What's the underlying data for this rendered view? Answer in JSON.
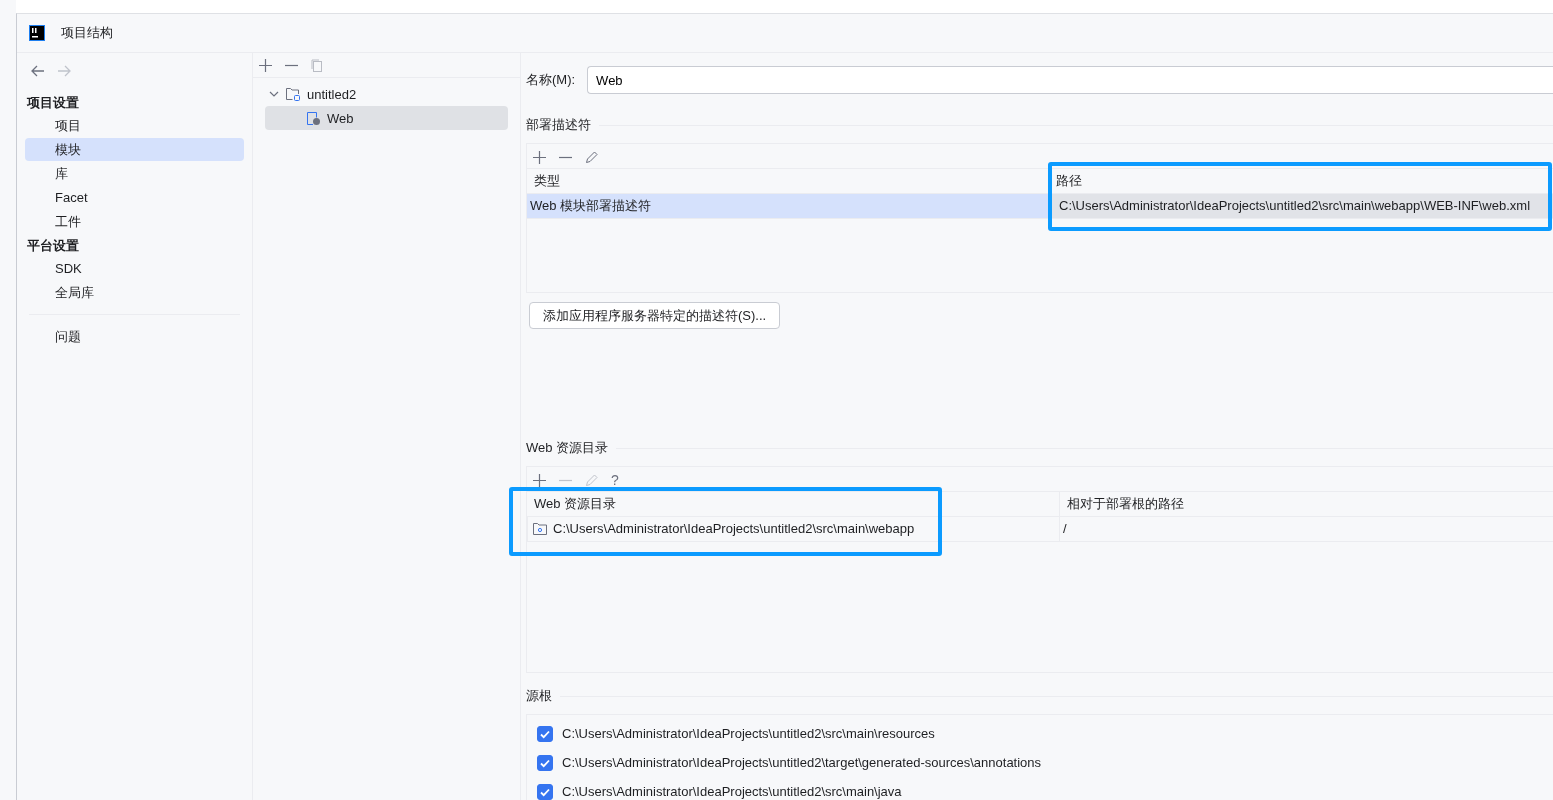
{
  "window": {
    "title": "项目结构"
  },
  "sidebar": {
    "sections": [
      {
        "heading": "项目设置",
        "items": [
          {
            "label": "项目",
            "selected": false
          },
          {
            "label": "模块",
            "selected": true
          },
          {
            "label": "库",
            "selected": false
          },
          {
            "label": "Facet",
            "selected": false
          },
          {
            "label": "工件",
            "selected": false
          }
        ]
      },
      {
        "heading": "平台设置",
        "items": [
          {
            "label": "SDK",
            "selected": false
          },
          {
            "label": "全局库",
            "selected": false
          }
        ]
      }
    ],
    "extra_items": [
      {
        "label": "问题",
        "selected": false
      }
    ]
  },
  "module_tree": [
    {
      "label": "untitled2",
      "expanded": true,
      "selected": false,
      "children": [
        {
          "label": "Web",
          "selected": true
        }
      ]
    }
  ],
  "name_field": {
    "label": "名称(M):",
    "value": "Web"
  },
  "deployment_descriptors": {
    "heading": "部署描述符",
    "columns": [
      "类型",
      "路径"
    ],
    "rows": [
      {
        "cells": [
          "Web 模块部署描述符",
          "C:\\Users\\Administrator\\IdeaProjects\\untitled2\\src\\main\\webapp\\WEB-INF\\web.xml"
        ],
        "selected": true
      }
    ],
    "add_button": "添加应用程序服务器特定的描述符(S)..."
  },
  "web_resources": {
    "heading": "Web 资源目录",
    "columns": [
      "Web 资源目录",
      "相对于部署根的路径"
    ],
    "rows": [
      {
        "cells": [
          "C:\\Users\\Administrator\\IdeaProjects\\untitled2\\src\\main\\webapp",
          "/"
        ],
        "selected": false
      }
    ],
    "help": "?"
  },
  "source_roots": {
    "heading": "源根",
    "items": [
      {
        "path": "C:\\Users\\Administrator\\IdeaProjects\\untitled2\\src\\main\\resources",
        "checked": true
      },
      {
        "path": "C:\\Users\\Administrator\\IdeaProjects\\untitled2\\target\\generated-sources\\annotations",
        "checked": true
      },
      {
        "path": "C:\\Users\\Administrator\\IdeaProjects\\untitled2\\src\\main\\java",
        "checked": true
      }
    ]
  }
}
